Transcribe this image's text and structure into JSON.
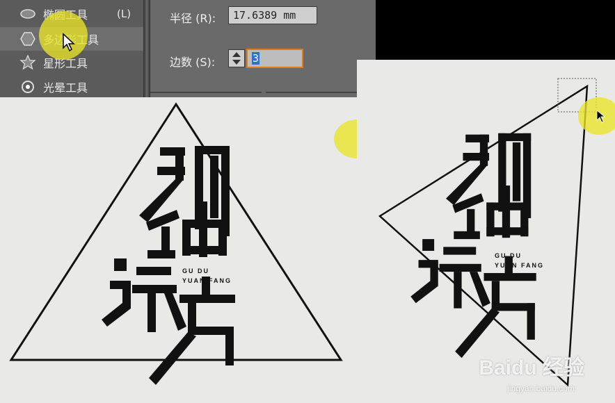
{
  "tool_menu": {
    "items": [
      {
        "label": "椭圆工具",
        "shortcut": "(L)",
        "icon": "ellipse-icon"
      },
      {
        "label": "多边形工具",
        "shortcut": "",
        "icon": "polygon-icon"
      },
      {
        "label": "星形工具",
        "shortcut": "",
        "icon": "star-icon"
      },
      {
        "label": "光晕工具",
        "shortcut": "",
        "icon": "flare-icon"
      }
    ]
  },
  "polygon_dialog": {
    "radius_label": "半径 (R):",
    "radius_value": "17.6389 mm",
    "sides_label": "边数 (S):",
    "sides_value": "3"
  },
  "artwork": {
    "title_chars": "孤独远方",
    "subtitle_line1": "GU DU",
    "subtitle_line2": "YUAN FANG"
  },
  "watermark": {
    "brand": "Baidu 经验",
    "url": "jingyan.baidu.com"
  },
  "colors": {
    "highlight": "#e9e428",
    "canvas": "#e9eae8",
    "menu_bg": "#5b5b5b",
    "dialog_bg": "#6a6a6a",
    "selected_field_border": "#e07a1a"
  }
}
